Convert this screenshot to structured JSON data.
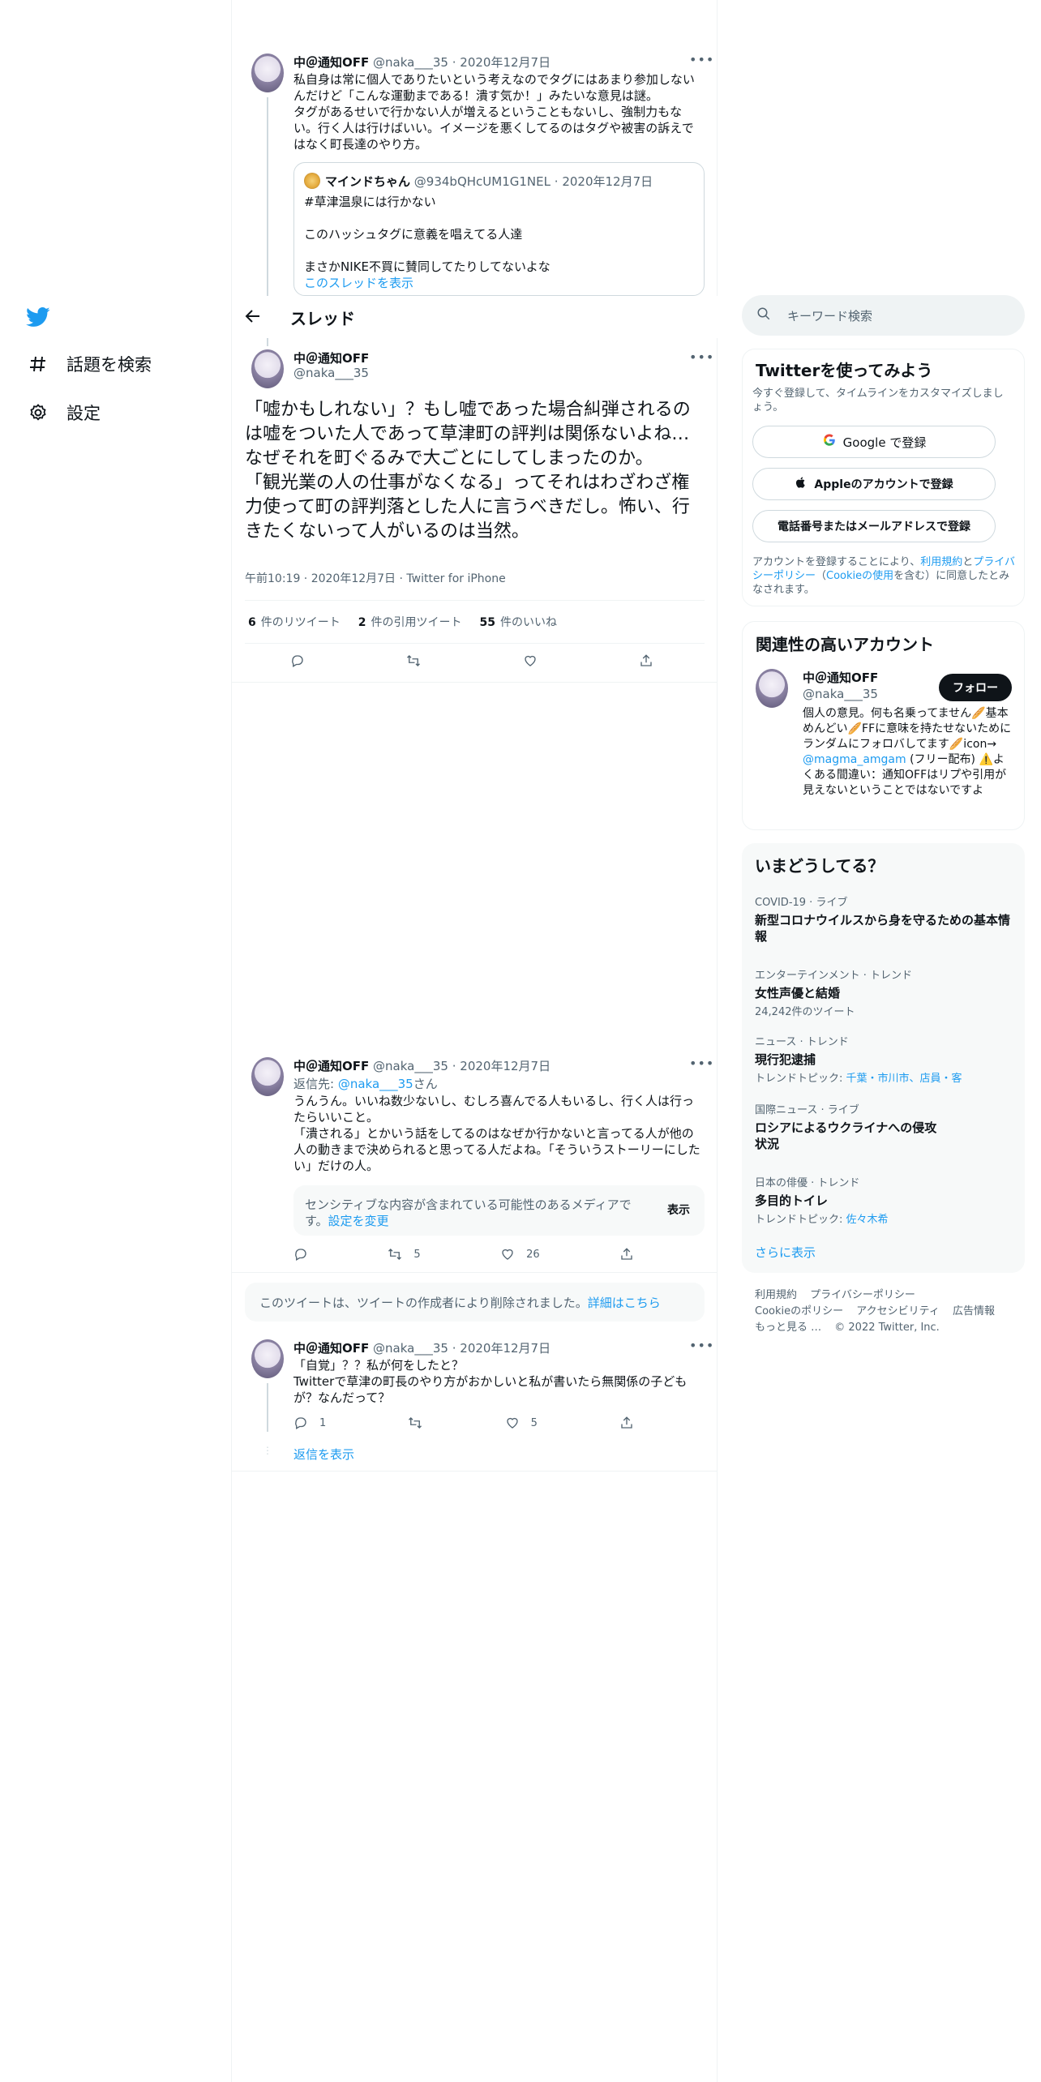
{
  "nav": {
    "items": [
      {
        "label": "話題を検索",
        "icon": "hashtag-icon"
      },
      {
        "label": "設定",
        "icon": "gear-icon"
      }
    ]
  },
  "header": {
    "title": "スレッド"
  },
  "parent": {
    "name": "中＠通知OFF",
    "handle": "@naka___35",
    "date": "2020年12月7日",
    "text": "私自身は常に個人でありたいという考えなのでタグにはあまり参加しないんだけど「こんな運動まである！潰す気か！」みたいな意見は謎。\nタグがあるせいで行かない人が増えるということもないし、強制力もない。行く人は行けばいい。イメージを悪くしてるのはタグや被害の訴えではなく町長達のやり方。",
    "quote": {
      "name": "マインドちゃん",
      "handle": "@934bQHcUM1G1NEL",
      "date": "2020年12月7日",
      "line1": "#草津温泉には行かない",
      "line2": "このハッシュタグに意義を唱えてる人達",
      "line3": "まさかNIKE不買に賛同してたりしてないよな",
      "show_thread": "このスレッドを表示"
    }
  },
  "focus": {
    "name": "中＠通知OFF",
    "handle": "@naka___35",
    "text": "「嘘かもしれない」？もし嘘であった場合糾弾されるのは嘘をついた人であって草津町の評判は関係ないよね…なぜそれを町ぐるみで大ごとにしてしまったのか。\n「観光業の人の仕事がなくなる」ってそれはわざわざ権力使って町の評判落とした人に言うべきだし。怖い、行きたくないって人がいるのは当然。",
    "meta": "午前10:19 · 2020年12月7日 · Twitter for iPhone",
    "retweets_n": "6",
    "retweets_label": "件のリツイート",
    "quotes_n": "2",
    "quotes_label": "件の引用ツイート",
    "likes_n": "55",
    "likes_label": "件のいいね"
  },
  "reply1": {
    "name": "中＠通知OFF",
    "handle": "@naka___35",
    "date": "2020年12月7日",
    "reply_to_prefix": "返信先: ",
    "reply_to_handle": "@naka___35",
    "reply_to_suffix": "さん",
    "text": "うんうん。いいね数少ないし、むしろ喜んでる人もいるし、行く人は行ったらいいこと。\n「潰される」とかいう話をしてるのはなぜか行かないと言ってる人が他の人の動きまで決められると思ってる人だよね。「そういうストーリーにしたい」だけの人。",
    "sensitive_text": "センシティブな内容が含まれている可能性のあるメディアです。",
    "sensitive_link": "設定を変更",
    "show_label": "表示",
    "retweets": "5",
    "likes": "26"
  },
  "deleted": {
    "text": "このツイートは、ツイートの作成者により削除されました。",
    "link": "詳細はこちら"
  },
  "reply2": {
    "name": "中＠通知OFF",
    "handle": "@naka___35",
    "date": "2020年12月7日",
    "text": "「自覚」？？私が何をしたと？\nTwitterで草津の町長のやり方がおかしいと私が書いたら無関係の子どもが？なんだって？",
    "replies": "1",
    "likes": "5",
    "show_replies": "返信を表示"
  },
  "search": {
    "placeholder": "キーワード検索"
  },
  "signup": {
    "title": "Twitterを使ってみよう",
    "subtitle": "今すぐ登録して、タイムラインをカスタマイズしましょう。",
    "google": "Google で登録",
    "apple": "Appleのアカウントで登録",
    "phone": "電話番号またはメールアドレスで登録",
    "legal_1": "アカウントを登録することにより、",
    "legal_terms": "利用規約",
    "legal_and": "と",
    "legal_privacy": "プライバシーポリシー",
    "legal_open": "（",
    "legal_cookie": "Cookieの使用",
    "legal_2": "を含む）に同意したとみなされます。"
  },
  "related": {
    "title": "関連性の高いアカウント",
    "name": "中＠通知OFF",
    "handle": "@naka___35",
    "follow": "フォロー",
    "bio_1": "個人の意見。何も名乗ってません🥖基本めんどい🥖FFに意味を持たせないためにランダムにフォロバしてます🥖icon→ ",
    "bio_link": "@magma_amgam",
    "bio_2": " (フリー配布) ⚠️よくある間違い：通知OFFはリプや引用が見えないということではないですよ"
  },
  "trends": {
    "title": "いまどうしてる？",
    "items": [
      {
        "ctx": "COVID-19 · ライブ",
        "title": "新型コロナウイルスから身を守るための基本情報",
        "sub": ""
      },
      {
        "ctx": "エンターテインメント · トレンド",
        "title": "女性声優と結婚",
        "sub": "24,242件のツイート"
      },
      {
        "ctx": "ニュース · トレンド",
        "title": "現行犯逮捕",
        "sub_prefix": "トレンドトピック: ",
        "sub_link": "千葉・市川市、店員・客"
      },
      {
        "ctx": "国際ニュース · ライブ",
        "title": "ロシアによるウクライナへの侵攻状況",
        "sub": ""
      },
      {
        "ctx": "日本の俳優 · トレンド",
        "title": "多目的トイレ",
        "sub_prefix": "トレンドトピック: ",
        "sub_link": "佐々木希"
      }
    ],
    "more": "さらに表示"
  },
  "footer": {
    "links": [
      "利用規約",
      "プライバシーポリシー",
      "Cookieのポリシー",
      "アクセシビリティ",
      "広告情報",
      "もっと見る …"
    ],
    "copyright": "© 2022 Twitter, Inc."
  },
  "colors": {
    "accent": "#1d9bf0",
    "text": "#0f1419",
    "muted": "#536471",
    "border": "#eff3f4"
  }
}
